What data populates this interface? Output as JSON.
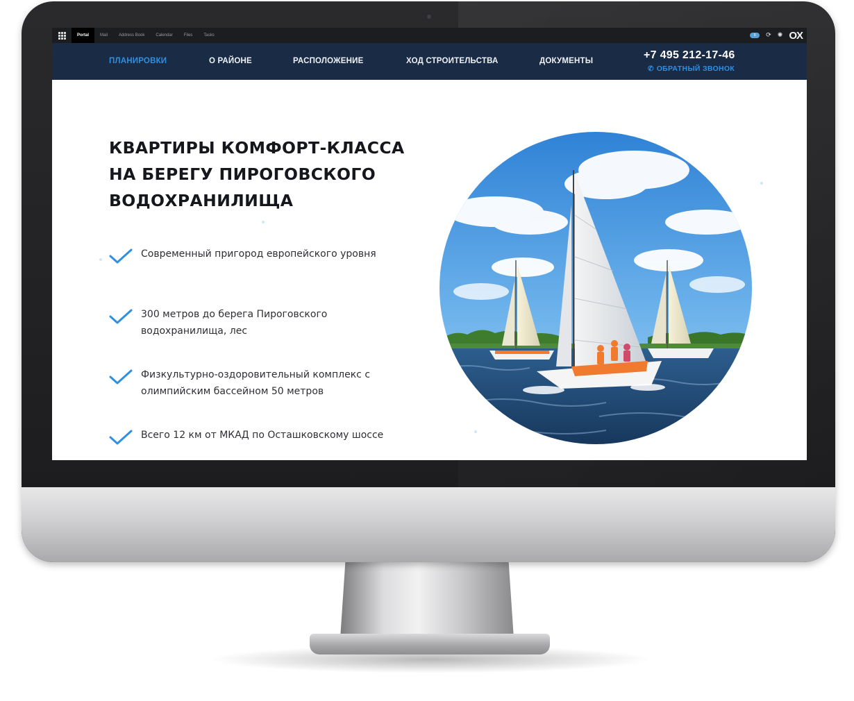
{
  "app_bar": {
    "tabs": [
      "Portal",
      "Mail",
      "Address Book",
      "Calendar",
      "Files",
      "Tasks"
    ],
    "active_tab": "Portal",
    "badge": "6",
    "logo": "OX"
  },
  "nav": {
    "items": [
      "Планировки",
      "О районе",
      "Расположение",
      "Ход строительства",
      "Документы"
    ],
    "active_item": "Планировки",
    "phone": "+7 495 212-17-46",
    "callback": "Обратный звонок"
  },
  "hero": {
    "title_lines": [
      "КВАРТИРЫ КОМФОРТ-КЛАССА",
      "НА БЕРЕГУ ПИРОГОВСКОГО",
      "ВОДОХРАНИЛИЩА"
    ],
    "features": [
      "Современный пригород европейского уровня",
      "300 метров до берега Пироговского водохранилища, лес",
      "Физкультурно-оздоровительный комплекс с олимпийским бассейном 50 метров",
      "Всего 12 км от МКАД по Осташковскому шоссе"
    ],
    "image_name": "sailboats-photo"
  },
  "colors": {
    "nav_bg": "#1a2b45",
    "accent": "#2f8fe0",
    "title": "#15171c",
    "app_bar_bg": "#1c1d20"
  }
}
